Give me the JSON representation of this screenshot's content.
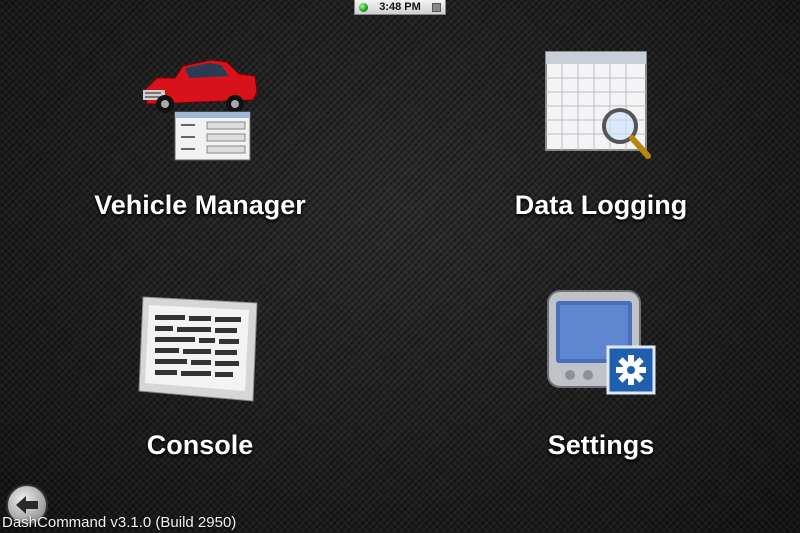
{
  "status_bar": {
    "time": "3:48 PM"
  },
  "menu": {
    "vehicle_manager": "Vehicle Manager",
    "data_logging": "Data Logging",
    "console": "Console",
    "settings": "Settings"
  },
  "footer": {
    "version": "DashCommand v3.1.0 (Build 2950)"
  },
  "icons": {
    "vehicle_manager": "pickup-truck-icon",
    "data_logging": "spreadsheet-magnifier-icon",
    "console": "console-text-icon",
    "settings": "device-gear-icon",
    "back": "back-arrow-icon"
  },
  "colors": {
    "truck": "#d8121a",
    "status_led": "#1b9e1b",
    "gear": "#1f5fb0"
  }
}
